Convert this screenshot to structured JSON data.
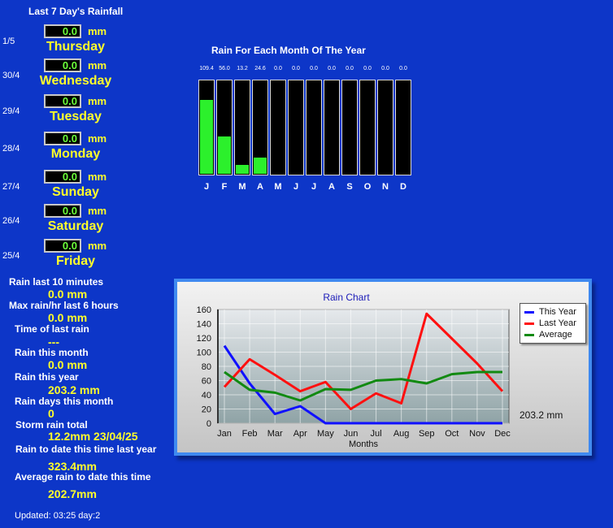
{
  "last7": {
    "title": "Last 7 Day's Rainfall",
    "unit": "mm",
    "days": [
      {
        "date": "1/5",
        "value": "0.0",
        "name": "Thursday"
      },
      {
        "date": "30/4",
        "value": "0.0",
        "name": "Wednesday"
      },
      {
        "date": "29/4",
        "value": "0.0",
        "name": "Tuesday"
      },
      {
        "date": "28/4",
        "value": "0.0",
        "name": "Monday"
      },
      {
        "date": "27/4",
        "value": "0.0",
        "name": "Sunday"
      },
      {
        "date": "26/4",
        "value": "0.0",
        "name": "Saturday"
      },
      {
        "date": "25/4",
        "value": "0.0",
        "name": "Friday"
      }
    ]
  },
  "stats": [
    {
      "label": "Rain last 10 minutes",
      "value": "0.0 mm"
    },
    {
      "label": "Max rain/hr last 6 hours",
      "value": "0.0 mm"
    },
    {
      "label": "Time of last rain",
      "value": "---"
    },
    {
      "label": "Rain this month",
      "value": "0.0 mm"
    },
    {
      "label": "Rain this year",
      "value": "203.2 mm"
    },
    {
      "label": "Rain days this month",
      "value": "0"
    },
    {
      "label": "Storm rain total",
      "value": "12.2mm 23/04/25"
    },
    {
      "label": "Rain to date this time last year",
      "value": "323.4mm"
    },
    {
      "label": "Average rain to date this time",
      "value": "202.7mm"
    }
  ],
  "updated": "Updated: 03:25 day:2",
  "monthly": {
    "title": "Rain For Each Month Of The Year",
    "months": [
      "J",
      "F",
      "M",
      "A",
      "M",
      "J",
      "J",
      "A",
      "S",
      "O",
      "N",
      "D"
    ],
    "value_labels": [
      "109.4",
      "56.0",
      "13.2",
      "24.6",
      "0.0",
      "0.0",
      "0.0",
      "0.0",
      "0.0",
      "0.0",
      "0.0",
      "0.0"
    ],
    "max": 140,
    "colors": {
      "bar": "#2cf02c",
      "column": "#000000"
    }
  },
  "chart_data": {
    "type": "line",
    "title": "Rain Chart",
    "xlabel": "Months",
    "ylabel": "",
    "categories": [
      "Jan",
      "Feb",
      "Mar",
      "Apr",
      "May",
      "Jun",
      "Jul",
      "Aug",
      "Sep",
      "Oct",
      "Nov",
      "Dec"
    ],
    "ylim": [
      0,
      160
    ],
    "yticks": [
      0,
      20,
      40,
      60,
      80,
      100,
      120,
      140,
      160
    ],
    "grid": true,
    "legend": "top-right",
    "annotation": "203.2 mm",
    "series": [
      {
        "name": "This Year",
        "color": "#1010ff",
        "values": [
          109,
          56,
          13,
          24,
          0,
          0,
          0,
          0,
          0,
          0,
          0,
          0
        ]
      },
      {
        "name": "Last Year",
        "color": "#ff1010",
        "values": [
          51,
          90,
          68,
          45,
          58,
          20,
          42,
          28,
          154,
          119,
          84,
          45
        ]
      },
      {
        "name": "Average",
        "color": "#128a12",
        "values": [
          72,
          47,
          43,
          32,
          48,
          47,
          60,
          62,
          56,
          69,
          72,
          72
        ]
      }
    ]
  }
}
